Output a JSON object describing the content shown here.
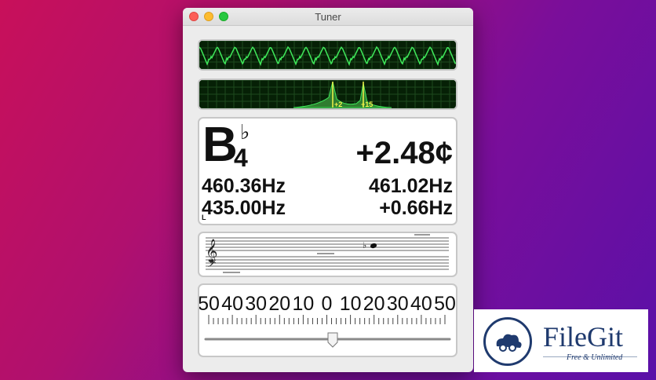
{
  "window": {
    "title": "Tuner"
  },
  "spectrum": {
    "peak_labels": [
      "+2",
      "+15"
    ]
  },
  "reading": {
    "note": "B",
    "accidental": "♭",
    "octave": "4",
    "cents": "+2.48¢",
    "detected_freq": "460.36Hz",
    "target_freq": "461.02Hz",
    "reference_freq": "435.00Hz",
    "freq_diff": "+0.66Hz",
    "corner_label": "L"
  },
  "staff": {
    "accidental": "♭"
  },
  "meter": {
    "scale_labels": [
      "50",
      "40",
      "30",
      "20",
      "10",
      "0",
      "10",
      "20",
      "30",
      "40",
      "50"
    ],
    "slider_level_cents": 2.48
  },
  "watermark": {
    "name": "FileGit",
    "tagline": "Free & Unlimited"
  },
  "colors": {
    "scope_bg": "#062006",
    "wave": "#3fe85a",
    "peak_label": "#f4f44a"
  }
}
